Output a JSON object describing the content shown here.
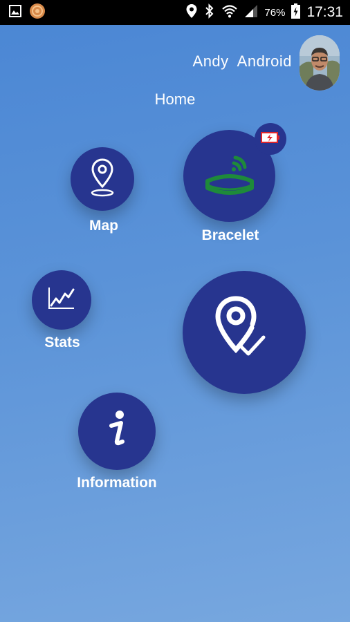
{
  "status_bar": {
    "battery_percent": "76%",
    "time": "17:31",
    "icons": [
      "image-icon",
      "app-badge-icon",
      "location-icon",
      "bluetooth-icon",
      "wifi-icon",
      "signal-icon",
      "battery-charging-icon"
    ]
  },
  "header": {
    "user_name": "Andy  Android",
    "page_title": "Home"
  },
  "menu": {
    "map": "Map",
    "bracelet": "Bracelet",
    "stats": "Stats",
    "information": "Information"
  },
  "colors": {
    "circle": "#27358f",
    "background_top": "#4a86d4",
    "background_bottom": "#77a7df",
    "bracelet_green": "#1e8a3a",
    "battery_alert_red": "#e0262b"
  }
}
